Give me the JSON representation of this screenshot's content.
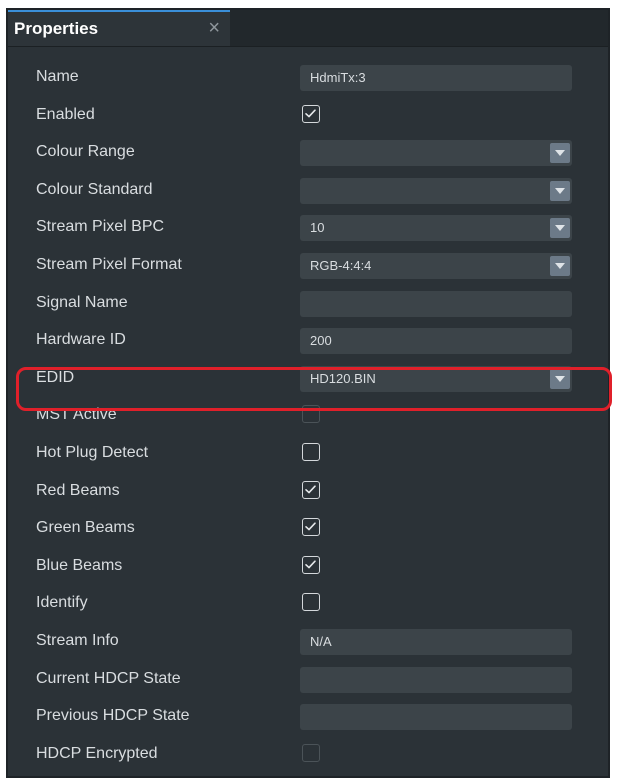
{
  "tab": {
    "title": "Properties",
    "close_glyph": "×"
  },
  "properties": [
    {
      "label": "Name",
      "type": "text",
      "value": "HdmiTx:3"
    },
    {
      "label": "Enabled",
      "type": "checkbox",
      "checked": true,
      "disabled": false
    },
    {
      "label": "Colour Range",
      "type": "dropdown",
      "value": ""
    },
    {
      "label": "Colour Standard",
      "type": "dropdown",
      "value": ""
    },
    {
      "label": "Stream Pixel BPC",
      "type": "dropdown",
      "value": "10"
    },
    {
      "label": "Stream Pixel Format",
      "type": "dropdown",
      "value": "RGB-4:4:4"
    },
    {
      "label": "Signal Name",
      "type": "text",
      "value": ""
    },
    {
      "label": "Hardware ID",
      "type": "text",
      "value": "200"
    },
    {
      "label": "EDID",
      "type": "dropdown",
      "value": "HD120.BIN",
      "highlighted": true
    },
    {
      "label": "MST Active",
      "type": "checkbox",
      "checked": false,
      "disabled": true
    },
    {
      "label": "Hot Plug Detect",
      "type": "checkbox",
      "checked": false,
      "disabled": false
    },
    {
      "label": "Red Beams",
      "type": "checkbox",
      "checked": true,
      "disabled": false
    },
    {
      "label": "Green Beams",
      "type": "checkbox",
      "checked": true,
      "disabled": false
    },
    {
      "label": "Blue Beams",
      "type": "checkbox",
      "checked": true,
      "disabled": false
    },
    {
      "label": "Identify",
      "type": "checkbox",
      "checked": false,
      "disabled": false
    },
    {
      "label": "Stream Info",
      "type": "text",
      "value": "N/A"
    },
    {
      "label": "Current HDCP State",
      "type": "text",
      "value": ""
    },
    {
      "label": "Previous HDCP State",
      "type": "text",
      "value": ""
    },
    {
      "label": "HDCP Encrypted",
      "type": "checkbox",
      "checked": false,
      "disabled": true
    }
  ],
  "colors": {
    "panel_bg": "#2b3237",
    "field_bg": "#3c4449",
    "dropdown_button": "#6c7a88",
    "highlight": "#e0202a",
    "tab_accent": "#3a8fd9"
  },
  "icons": {
    "close": "close-icon",
    "dropdown": "chevron-down-icon",
    "check": "checkmark-icon"
  }
}
